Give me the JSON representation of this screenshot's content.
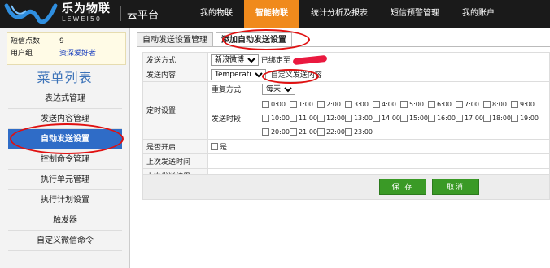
{
  "header": {
    "brand_cn": "乐为物联",
    "brand_en": "LEWEI50",
    "platform": "云平台",
    "nav": [
      "我的物联",
      "智能物联",
      "统计分析及报表",
      "短信预警管理",
      "我的账户"
    ],
    "accent_color": "#f08a1c"
  },
  "sidebar": {
    "sms_label": "短信点数",
    "sms_value": "9",
    "group_label": "用户组",
    "group_value": "资深爱好者",
    "menu_title": "菜单列表",
    "items": [
      "表达式管理",
      "发送内容管理",
      "自动发送设置",
      "控制命令管理",
      "执行单元管理",
      "执行计划设置",
      "触发器",
      "自定义微信命令"
    ],
    "active_item": "自动发送设置",
    "active_color": "#2f6cc7"
  },
  "tabs": [
    "自动发送设置管理",
    "添加自动发送设置"
  ],
  "form": {
    "send_method_label": "发送方式",
    "send_method_value": "新浪微博",
    "bound_text": "已绑定至",
    "content_label": "发送内容",
    "content_value": "Temperature",
    "custom_content_link": "自定义发送内容",
    "timing_label": "定时设置",
    "repeat_label": "重复方式",
    "repeat_value": "每天",
    "period_label": "发送时段",
    "hours": [
      "0:00",
      "1:00",
      "2:00",
      "3:00",
      "4:00",
      "5:00",
      "6:00",
      "7:00",
      "8:00",
      "9:00",
      "10:00",
      "11:00",
      "12:00",
      "13:00",
      "14:00",
      "15:00",
      "16:00",
      "17:00",
      "18:00",
      "19:00",
      "20:00",
      "21:00",
      "22:00",
      "23:00"
    ],
    "enabled_label": "是否开启",
    "enabled_option": "是",
    "last_time_label": "上次发送时间",
    "last_result_label": "上次发送结果"
  },
  "buttons": {
    "save": "保 存",
    "cancel": "取消",
    "color": "#3a9a26"
  }
}
